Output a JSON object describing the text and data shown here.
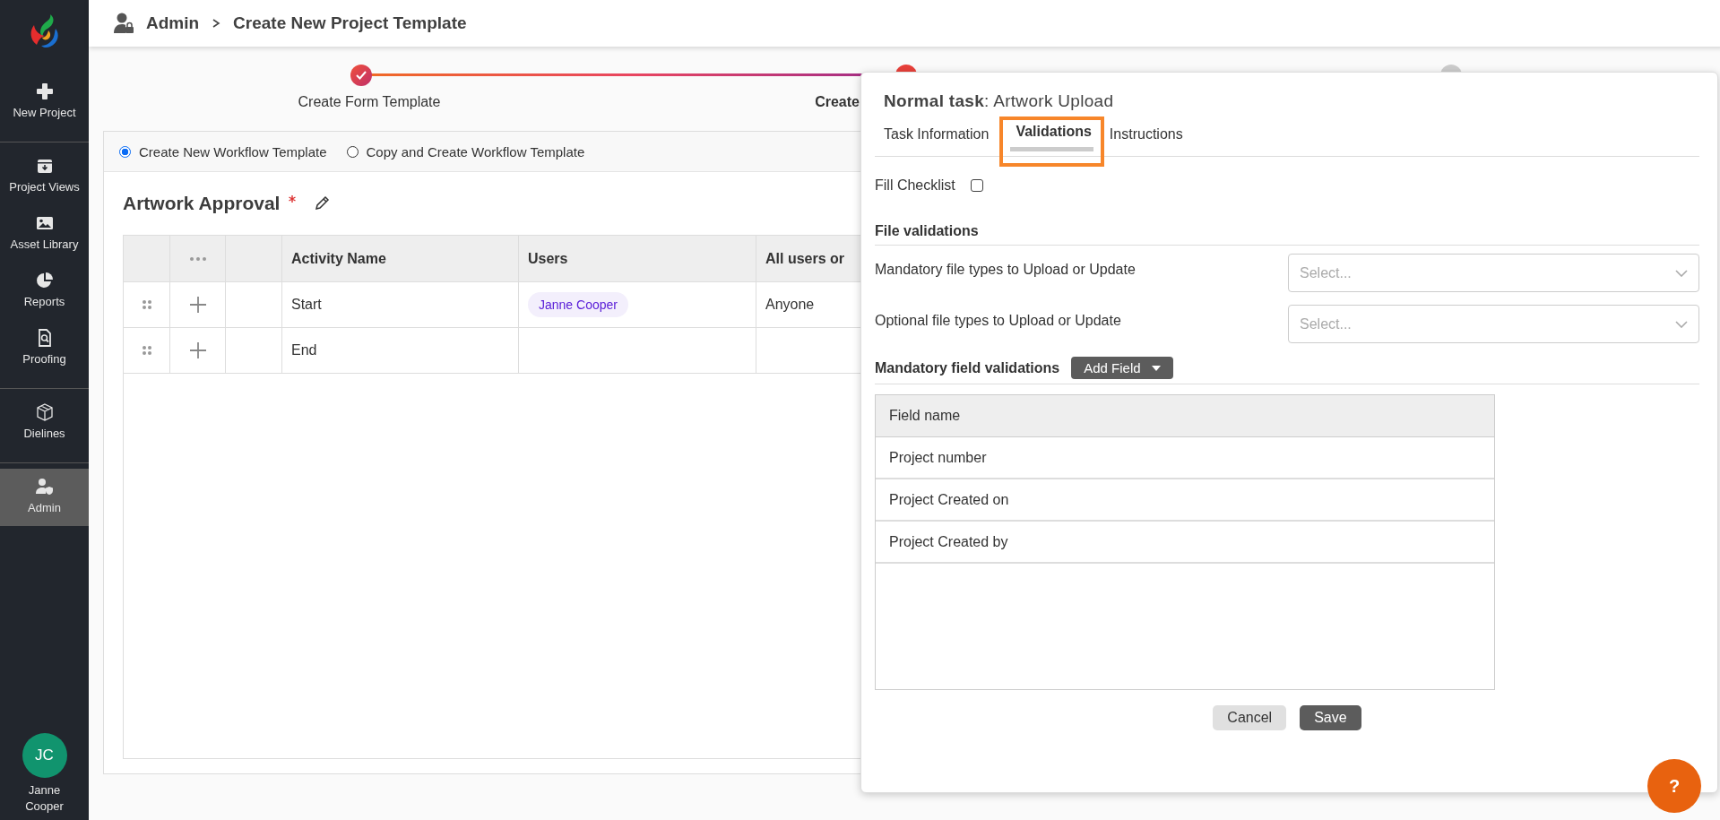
{
  "sidebar": {
    "sections": [
      [
        {
          "label": "New Project",
          "kind": "plus",
          "selected": false
        }
      ],
      [
        {
          "label": "Project Views",
          "kind": "archive",
          "selected": false
        },
        {
          "label": "Asset Library",
          "kind": "image",
          "selected": false
        },
        {
          "label": "Reports",
          "kind": "pie",
          "selected": false
        },
        {
          "label": "Proofing",
          "kind": "search-doc",
          "selected": false
        }
      ],
      [
        {
          "label": "Dielines",
          "kind": "box",
          "selected": false
        }
      ],
      [
        {
          "label": "Admin",
          "kind": "user-shield",
          "selected": true
        }
      ]
    ],
    "user": {
      "initials": "JC",
      "name": "Janne Cooper"
    }
  },
  "breadcrumb": [
    "Admin",
    "Create New Project Template"
  ],
  "stepper": [
    {
      "label": "Create Form Template",
      "kind": "done"
    },
    {
      "label": "Create",
      "kind": "current"
    },
    {
      "kind": "pending"
    }
  ],
  "workflow_options": [
    {
      "label": "Create New Workflow Template",
      "selected": true
    },
    {
      "label": "Copy and Create Workflow Template",
      "selected": false
    }
  ],
  "template": {
    "name": "Artwork Approval",
    "required": true
  },
  "table": {
    "columns": [
      "Activity Name",
      "Users",
      "All users or"
    ],
    "rows": [
      {
        "activity": "Start",
        "users": [
          "Janne Cooper"
        ],
        "assignment": "Anyone"
      },
      {
        "activity": "End",
        "users": []
      }
    ]
  },
  "panel": {
    "title": "**Normal task**: Artwork Upload",
    "tabs": [
      {
        "label": "Task Information",
        "selected": false
      },
      {
        "label": "Validations",
        "selected": true
      },
      {
        "label": "Instructions",
        "selected": false
      }
    ],
    "fill_checklist": {
      "label": "Fill Checklist",
      "checked": false
    },
    "file_validations": {
      "title": "File validations",
      "fields": [
        {
          "label": "Mandatory file types to Upload or Update",
          "placeholder": "Select..."
        },
        {
          "label": "Optional file types to Upload or Update",
          "placeholder": "Select..."
        }
      ]
    },
    "field_validations": {
      "title": "Mandatory field validations",
      "add_button": "Add Field",
      "column": "Field name",
      "rows": [
        "Project number",
        "Project Created on",
        "Project Created by"
      ]
    },
    "buttons": [
      {
        "label": "Cancel",
        "kind": "secondary"
      },
      {
        "label": "Save",
        "kind": "primary"
      }
    ]
  },
  "help_button": "?"
}
